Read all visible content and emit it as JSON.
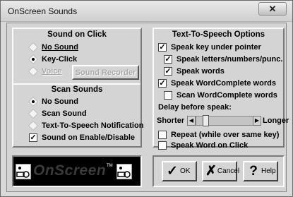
{
  "window": {
    "title": "OnScreen Sounds",
    "close_glyph": "✕"
  },
  "sound_on_click": {
    "heading": "Sound on Click",
    "options": [
      {
        "label": "No Sound",
        "selected": false,
        "enabled": true
      },
      {
        "label": "Key-Click",
        "selected": true,
        "enabled": true
      },
      {
        "label": "Voice",
        "selected": false,
        "enabled": false
      }
    ],
    "recorder_button": "Sound Recorder"
  },
  "scan_sounds": {
    "heading": "Scan Sounds",
    "options": [
      {
        "label": "No Sound",
        "selected": true
      },
      {
        "label": "Scan Sound",
        "selected": false
      },
      {
        "label": "Text-To-Speech Notification",
        "selected": false
      }
    ],
    "checkbox": {
      "label": "Sound on Enable/Disable",
      "checked": true
    }
  },
  "tts": {
    "heading": "Text-To-Speech Options",
    "checks": [
      {
        "label": "Speak key under pointer",
        "checked": true
      },
      {
        "label": "Speak letters/numbers/punc.",
        "checked": true
      },
      {
        "label": "Speak words",
        "checked": true
      },
      {
        "label": "Speak WordComplete words",
        "checked": true
      },
      {
        "label": "Scan WordComplete words",
        "checked": false
      }
    ],
    "delay_label": "Delay before speak:",
    "shorter_label": "Shorter",
    "longer_label": "Longer",
    "delay_level": 0.12,
    "extra_checks": [
      {
        "label": "Repeat (while over same key)",
        "checked": false
      },
      {
        "label": "Speak Word on Click",
        "checked": false
      }
    ]
  },
  "logo": {
    "text": "OnScreen",
    "tm": "TM"
  },
  "buttons": {
    "ok": "OK",
    "cancel": "Cancel",
    "help": "Help"
  },
  "glyphs": {
    "check": "✓",
    "cross": "✗",
    "question": "?",
    "left": "◀",
    "right": "▶"
  },
  "icons": [
    "close-icon",
    "wheelchair-keyboard-icon",
    "ok-check-icon",
    "cancel-x-icon",
    "help-question-icon"
  ]
}
